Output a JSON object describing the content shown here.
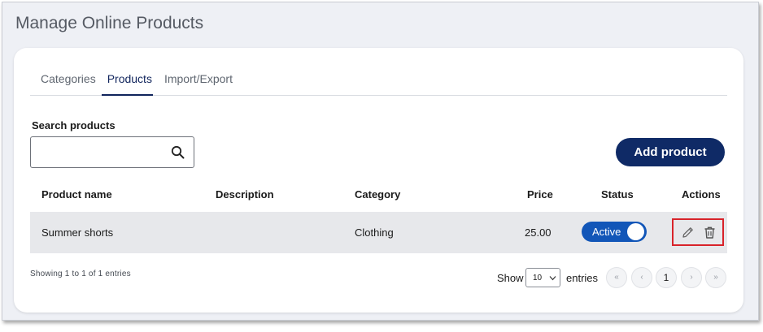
{
  "page": {
    "title": "Manage Online Products"
  },
  "tabs": [
    {
      "label": "Categories"
    },
    {
      "label": "Products"
    },
    {
      "label": "Import/Export"
    }
  ],
  "search": {
    "label": "Search products",
    "value": "",
    "placeholder": ""
  },
  "toolbar": {
    "add_label": "Add product"
  },
  "table": {
    "headers": {
      "name": "Product name",
      "description": "Description",
      "category": "Category",
      "price": "Price",
      "status": "Status",
      "actions": "Actions"
    },
    "rows": [
      {
        "name": "Summer shorts",
        "description": "",
        "category": "Clothing",
        "price": "25.00",
        "status": "Active"
      }
    ]
  },
  "footer": {
    "showing": "Showing 1 to 1 of 1 entries",
    "show_label": "Show",
    "page_size": "10",
    "entries_label": "entries",
    "pager": {
      "first": "«",
      "prev": "‹",
      "current": "1",
      "next": "›",
      "last": "»"
    }
  },
  "colors": {
    "accent": "#0f2a66",
    "toggle": "#1256b8",
    "highlight_border": "#d8232a",
    "row_bg": "#e7e8eb"
  },
  "icons": {
    "search": "search-icon",
    "edit": "pencil-icon",
    "delete": "trash-icon",
    "select": "chevron-down-icon"
  }
}
